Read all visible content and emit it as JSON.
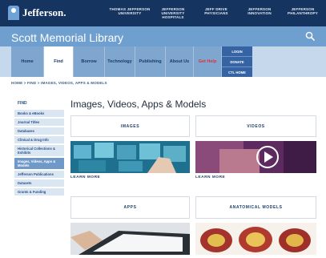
{
  "header": {
    "logo_text": "Jefferson.",
    "links": [
      {
        "line1": "THOMAS JEFFERSON",
        "line2": "UNIVERSITY"
      },
      {
        "line1": "JEFFERSON UNIVERSITY",
        "line2": "HOSPITALS"
      },
      {
        "line1": "JEFF DRIVE",
        "line2": "PHYSICIANS"
      },
      {
        "line1": "JEFFERSON",
        "line2": "INNOVATION"
      },
      {
        "line1": "JEFFERSON",
        "line2": "PHILANTHROPY"
      }
    ]
  },
  "site": {
    "title": "Scott Memorial Library",
    "search_icon": "search-icon"
  },
  "nav": {
    "items": [
      "Home",
      "Find",
      "Borrow",
      "Technology",
      "Publishing",
      "About Us",
      "Get Help"
    ],
    "active": "Find",
    "side": [
      "LOGIN",
      "DONATE",
      "CTL HOME"
    ]
  },
  "breadcrumb": "HOME > FIND > IMAGES, VIDEOS, APPS & MODELS",
  "sidebar": {
    "heading": "FIND",
    "items": [
      "Books & eBooks",
      "Journal Titles",
      "Databases",
      "Clinical & Drug Info",
      "Historical Collections & Exhibits",
      "Images, Videos, Apps & Models",
      "Jefferson Publications",
      "Datasets",
      "Grants & Funding"
    ],
    "active_index": 5
  },
  "main": {
    "title": "Images, Videos, Apps & Models",
    "cards": [
      {
        "label": "IMAGES",
        "link": "LEARN MORE"
      },
      {
        "label": "VIDEOS",
        "link": "LEARN MORE"
      },
      {
        "label": "APPS"
      },
      {
        "label": "ANATOMICAL MODELS"
      }
    ]
  },
  "colors": {
    "top_bar": "#15345f",
    "title_bar": "#6f9fcf",
    "nav_bar": "#c6d8ec",
    "nav_item": "#7ea6cf",
    "accent_red": "#d8333b",
    "sidebar_active": "#6f99c9"
  }
}
